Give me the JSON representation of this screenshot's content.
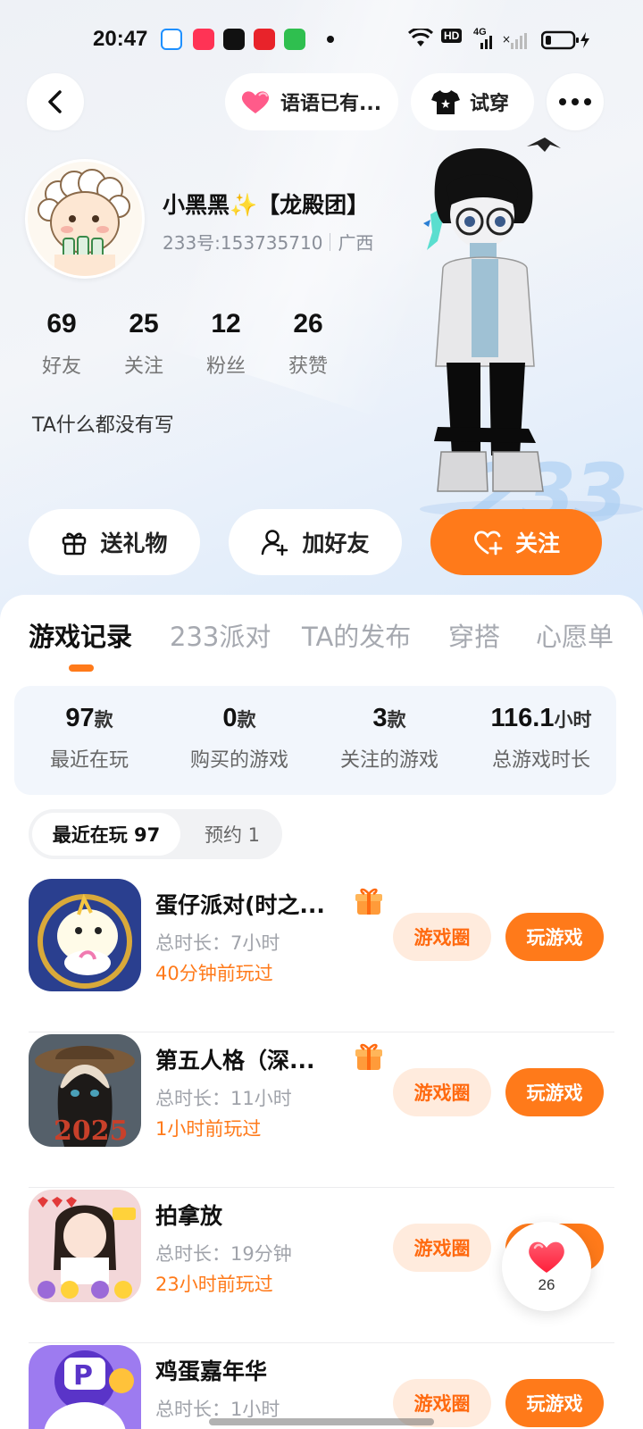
{
  "status_bar": {
    "time": "20:47",
    "network": "4G",
    "hd_label": "HD",
    "app_icons": [
      "search-app-icon",
      "video-app-icon",
      "tiktok-icon",
      "shopping-app-icon",
      "store-app-icon"
    ]
  },
  "nav": {
    "voice_status": "语语已有...",
    "try_on": "试穿"
  },
  "profile": {
    "nickname": "小黑黑✨【龙殿团】",
    "id_text": "233号:153735710",
    "region": "广西",
    "bio": "TA什么都没有写",
    "stats": [
      {
        "value": "69",
        "label": "好友"
      },
      {
        "value": "25",
        "label": "关注"
      },
      {
        "value": "12",
        "label": "粉丝"
      },
      {
        "value": "26",
        "label": "获赞"
      }
    ],
    "bg_text": "233"
  },
  "actions": {
    "gift": "送礼物",
    "add_friend": "加好友",
    "follow": "关注"
  },
  "tabs": [
    "游戏记录",
    "233派对",
    "TA的发布",
    "穿搭",
    "心愿单"
  ],
  "summary": [
    {
      "value": "97",
      "unit": "款",
      "label": "最近在玩"
    },
    {
      "value": "0",
      "unit": "款",
      "label": "购买的游戏"
    },
    {
      "value": "3",
      "unit": "款",
      "label": "关注的游戏"
    },
    {
      "value": "116.1",
      "unit": "小时",
      "label": "总游戏时长"
    }
  ],
  "filters": {
    "recent": "最近在玩 97",
    "reserve": "预约 1"
  },
  "games": [
    {
      "name": "蛋仔派对(时之...",
      "duration": "总时长：7小时",
      "last_played": "40分钟前玩过",
      "circle_label": "游戏圈",
      "play_label": "玩游戏",
      "has_gift": true
    },
    {
      "name": "第五人格（深...",
      "duration": "总时长：11小时",
      "last_played": "1小时前玩过",
      "circle_label": "游戏圈",
      "play_label": "玩游戏",
      "has_gift": true,
      "icon_text": "2025"
    },
    {
      "name": "拍拿放",
      "duration": "总时长：19分钟",
      "last_played": "23小时前玩过",
      "circle_label": "游戏圈",
      "play_label": "玩游戏",
      "has_gift": false
    },
    {
      "name": "鸡蛋嘉年华",
      "duration": "总时长：1小时",
      "last_played": "",
      "circle_label": "游戏圈",
      "play_label": "玩游戏",
      "has_gift": false
    }
  ],
  "like_fab": {
    "count": "26"
  },
  "colors": {
    "accent": "#ff7a1a",
    "accent_soft": "#ffebdd",
    "summary_bg": "#f2f6fc"
  }
}
